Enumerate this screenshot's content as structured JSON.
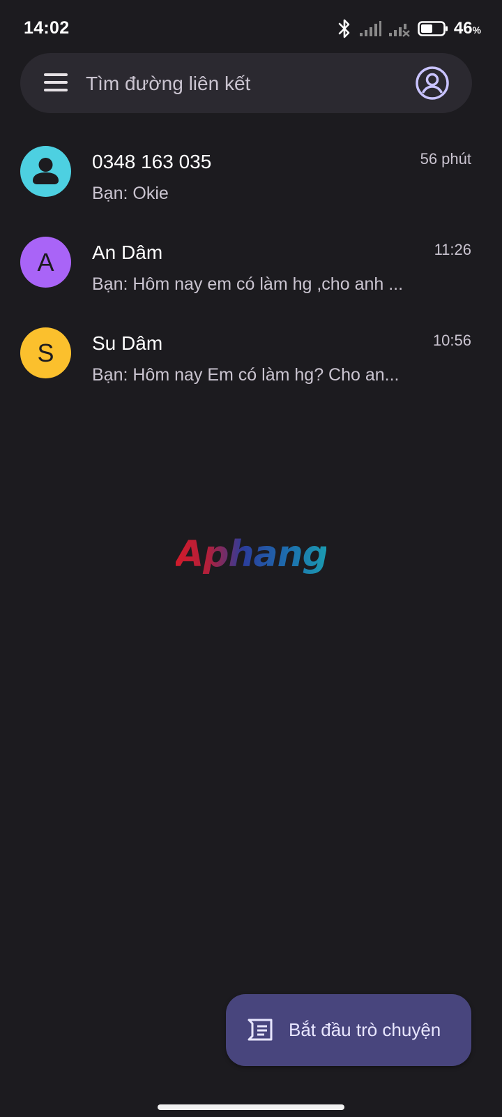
{
  "status_bar": {
    "time": "14:02",
    "battery_percent": "46",
    "battery_unit": "%",
    "icons": [
      "bluetooth-icon",
      "signal-icon",
      "signal-no-service-icon",
      "battery-icon"
    ]
  },
  "search": {
    "placeholder": "Tìm đường liên kết",
    "menu_icon": "menu-icon",
    "account_icon": "account-circle-icon"
  },
  "conversations": [
    {
      "avatar_type": "person-icon",
      "avatar_color": "#4dd0e1",
      "name": "0348 163 035",
      "snippet": "Bạn: Okie",
      "time": "56 phút"
    },
    {
      "avatar_letter": "A",
      "avatar_color": "#a964f7",
      "name": "An Dâm",
      "snippet": "Bạn: Hôm nay em có làm hg ,cho anh ...",
      "time": "11:26"
    },
    {
      "avatar_letter": "S",
      "avatar_color": "#fbc02d",
      "name": "Su Dâm",
      "snippet": "Bạn: Hôm nay Em có làm hg? Cho an...",
      "time": "10:56"
    }
  ],
  "watermark": "Aphang",
  "fab": {
    "label": "Bắt đầu trò chuyện",
    "icon": "new-message-icon"
  },
  "colors": {
    "background": "#1c1b1f",
    "search_bar": "#2b2930",
    "fab": "#48457d",
    "accent": "#c9c3ff"
  }
}
